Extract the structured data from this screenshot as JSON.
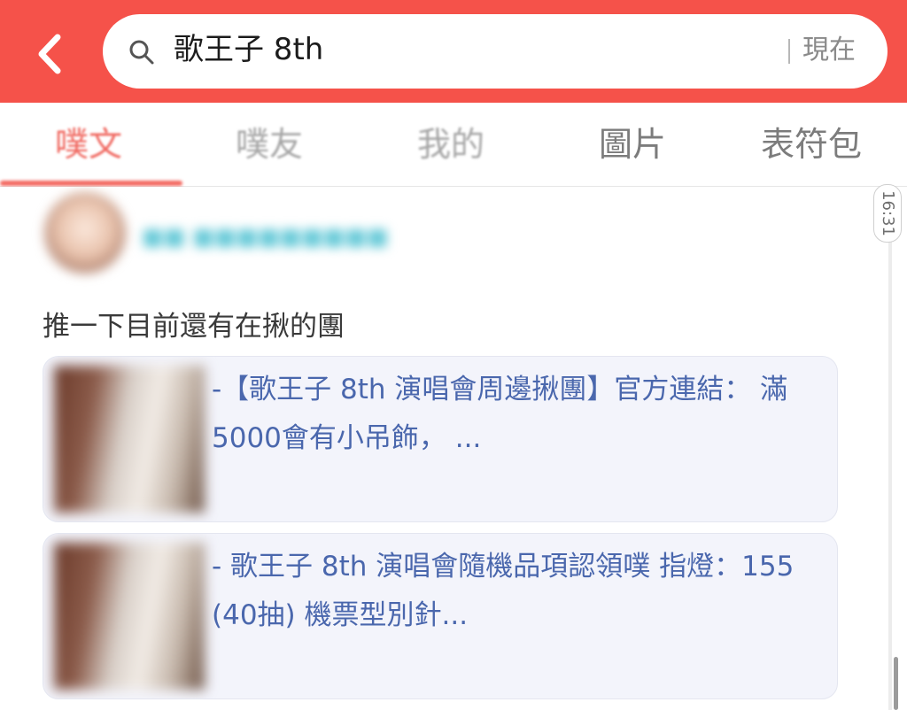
{
  "header": {
    "search_value": "歌王子 8th",
    "sort_label": "現在",
    "accent_color": "#f5524a"
  },
  "icons": {
    "back": "chevron-left-icon",
    "search": "search-icon"
  },
  "tabs": [
    {
      "label": "噗文",
      "active": true
    },
    {
      "label": "噗友",
      "active": false
    },
    {
      "label": "我的",
      "active": false
    },
    {
      "label": "圖片",
      "active": false
    },
    {
      "label": "表符包",
      "active": false
    }
  ],
  "post": {
    "text": "推一下目前還有在揪的團"
  },
  "link_cards": [
    {
      "title": "-【歌王子 8th 演唱會周邊揪團】官方連結： 滿5000會有小吊飾， ..."
    },
    {
      "title": "- 歌王子 8th 演唱會隨機品項認領噗 指燈：155 (40抽) 機票型別針..."
    }
  ],
  "timeline": {
    "time_label": "16:31"
  }
}
